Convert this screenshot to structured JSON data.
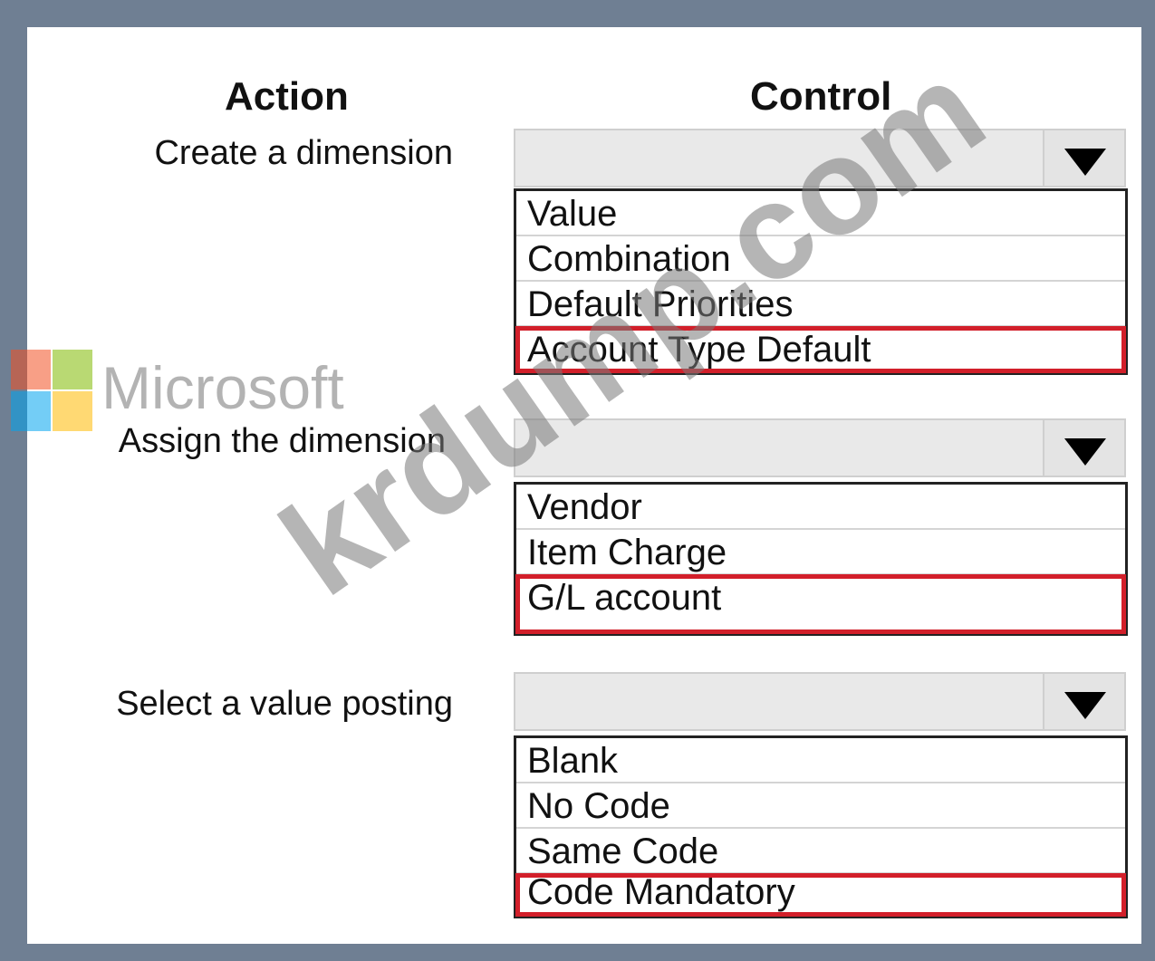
{
  "headers": {
    "action": "Action",
    "control": "Control"
  },
  "rows": [
    {
      "action": "Create a dimension",
      "options": [
        "Value",
        "Combination",
        "Default Priorities",
        "Account Type Default"
      ],
      "selected_index": 3
    },
    {
      "action": "Assign the dimension",
      "options": [
        "Vendor",
        "Item Charge",
        "G/L account"
      ],
      "selected_index": 2
    },
    {
      "action": "Select a value posting",
      "options": [
        "Blank",
        "No Code",
        "Same Code",
        "Code Mandatory"
      ],
      "selected_index": 3
    }
  ],
  "watermark": {
    "brand": "Microsoft",
    "site": "krdump.com"
  },
  "colors": {
    "selection_outline": "#d21f2a",
    "frame": "#6f7f93"
  }
}
